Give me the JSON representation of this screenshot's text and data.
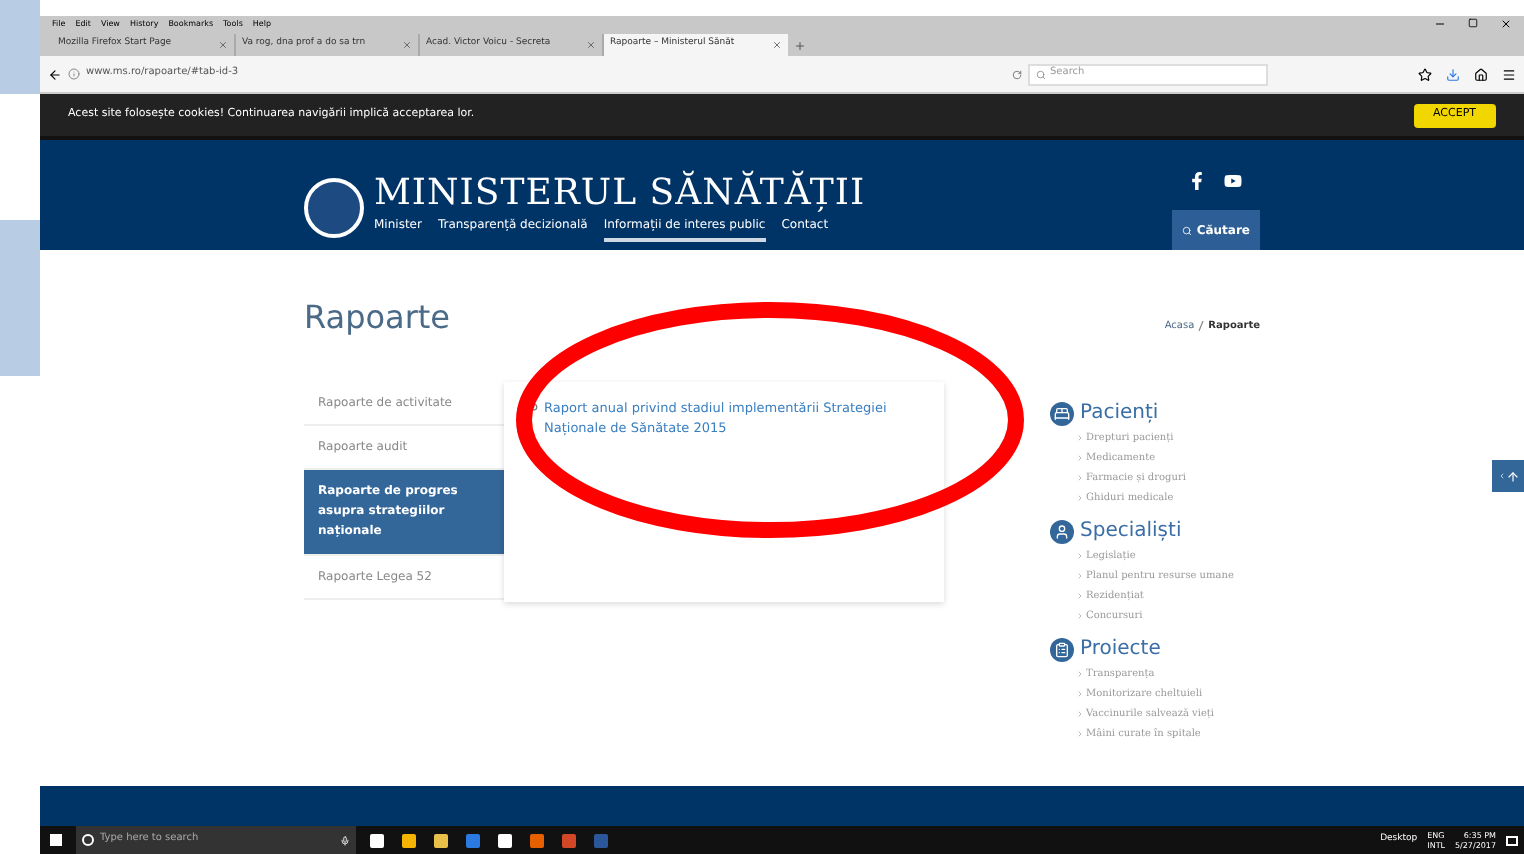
{
  "browser": {
    "menu": [
      "File",
      "Edit",
      "View",
      "History",
      "Bookmarks",
      "Tools",
      "Help"
    ],
    "tabs": [
      {
        "label": "Mozilla Firefox Start Page",
        "selected": false
      },
      {
        "label": "Va rog, dna prof a do sa trn",
        "selected": false
      },
      {
        "label": "Acad. Victor Voicu - Secreta",
        "selected": false
      },
      {
        "label": "Rapoarte – Ministerul Sănăt",
        "selected": true
      }
    ],
    "url": "www.ms.ro/rapoarte/#tab-id-3",
    "search": {
      "placeholder": "Search"
    }
  },
  "cookie_bar": {
    "text": "Acest site folosește cookies! Continuarea navigării implică acceptarea lor.",
    "button": "ACCEPT"
  },
  "header": {
    "title": "MINISTERUL SĂNĂTĂȚII",
    "nav": [
      {
        "label": "Minister",
        "selected": false
      },
      {
        "label": "Transparență decizională",
        "selected": false
      },
      {
        "label": "Informații de interes public",
        "selected": true
      },
      {
        "label": "Contact",
        "selected": false
      }
    ],
    "search_button": "Căutare"
  },
  "page": {
    "title": "Rapoarte",
    "breadcrumb": [
      "Acasa",
      "Rapoarte"
    ],
    "sidebar": [
      {
        "label": "Rapoarte de activitate",
        "selected": false
      },
      {
        "label": "Rapoarte audit",
        "selected": false
      },
      {
        "label": "Rapoarte de progres asupra strategiilor naționale",
        "selected": true
      },
      {
        "label": "Rapoarte Legea 52",
        "selected": false
      }
    ],
    "links": [
      "Raport anual privind stadiul implementării Strategiei Naționale de Sănătate 2015"
    ],
    "sections": [
      {
        "title": "Pacienți",
        "items": [
          "Drepturi pacienți",
          "Medicamente",
          "Farmacie și droguri",
          "Ghiduri medicale"
        ]
      },
      {
        "title": "Specialiști",
        "items": [
          "Legislație",
          "Planul pentru resurse umane",
          "Rezidențiat",
          "Concursuri"
        ]
      },
      {
        "title": "Proiecte",
        "items": [
          "Transparența",
          "Monitorizare cheltuieli",
          "Vaccinurile salvează vieți",
          "Mâini curate în spitale"
        ]
      }
    ]
  },
  "taskbar": {
    "search_placeholder": "Type here to search",
    "desktop": "Desktop",
    "lang": "ENG",
    "layout": "INTL",
    "time": "6:35 PM",
    "date": "5/27/2017"
  }
}
